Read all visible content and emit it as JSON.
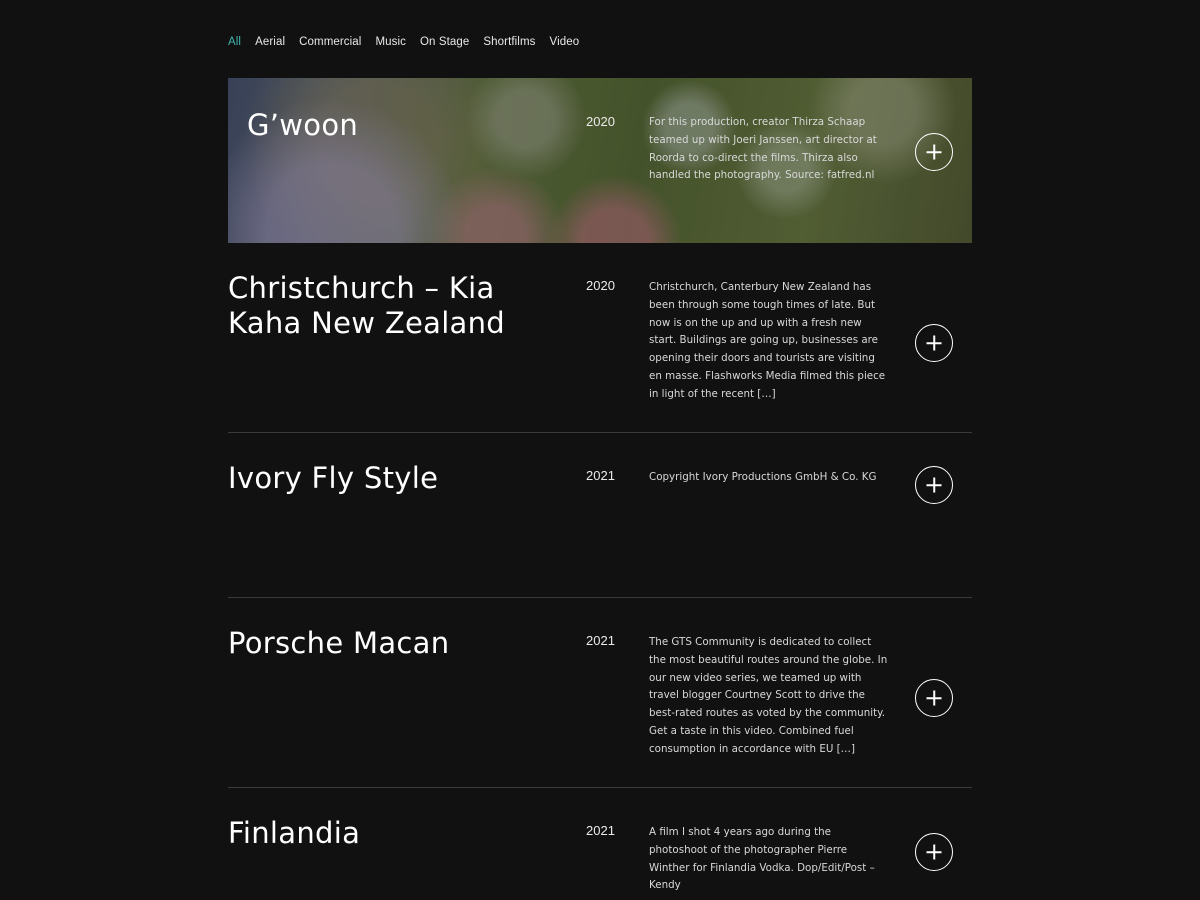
{
  "filters": [
    "All",
    "Aerial",
    "Commercial",
    "Music",
    "On Stage",
    "Shortfilms",
    "Video"
  ],
  "active_filter": "All",
  "accent_color": "#3fb5b0",
  "items": [
    {
      "title": "G’woon",
      "year": "2020",
      "description": "For this production, creator Thirza Schaap teamed up with Joeri Janssen, art director at Roorda to co-direct the films. Thirza also handled the photography. Source: fatfred.nl",
      "icon": "plus-circle-icon"
    },
    {
      "title": "Christchurch – Kia Kaha New Zealand",
      "year": "2020",
      "description": "Christchurch, Canterbury New Zealand has been through some tough times of late. But now is on the up and up with a fresh new start. Buildings are going up, businesses are opening their doors and tourists are visiting en masse. Flashworks Media filmed this piece in light of the recent […]",
      "icon": "plus-circle-icon"
    },
    {
      "title": "Ivory Fly Style",
      "year": "2021",
      "description": "Copyright Ivory Productions GmbH & Co. KG",
      "icon": "plus-circle-icon"
    },
    {
      "title": "Porsche Macan",
      "year": "2021",
      "description": "The GTS Community is dedicated to collect the most beautiful routes around the globe. In our new video series, we teamed up with travel blogger Courtney Scott to drive the best-rated routes as voted by the community. Get a taste in this video. Combined fuel consumption in accordance with EU […]",
      "icon": "plus-circle-icon"
    },
    {
      "title": "Finlandia",
      "year": "2021",
      "description": "A film I shot 4 years ago during the photoshoot of the photographer Pierre Winther for Finlandia Vodka. Dop/Edit/Post – Kendy",
      "icon": "plus-circle-icon"
    }
  ]
}
